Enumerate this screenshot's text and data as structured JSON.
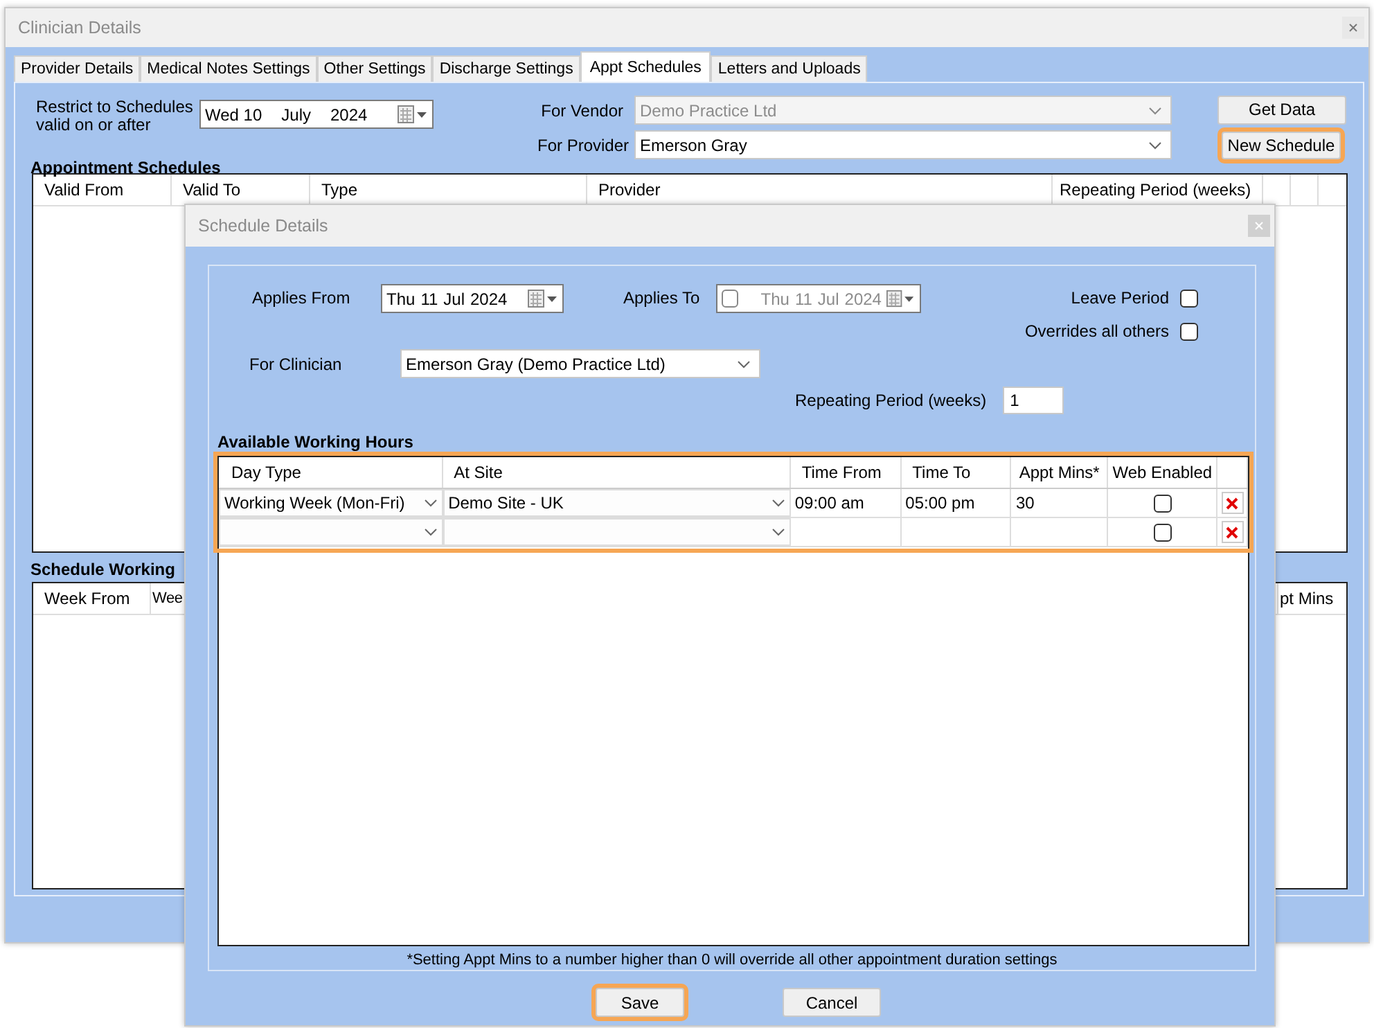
{
  "clinician_details": {
    "title": "Clinician Details",
    "tabs": [
      {
        "label": "Provider Details",
        "selected": false
      },
      {
        "label": "Medical Notes Settings",
        "selected": false
      },
      {
        "label": "Other Settings",
        "selected": false
      },
      {
        "label": "Discharge Settings",
        "selected": false
      },
      {
        "label": "Appt Schedules",
        "selected": true
      },
      {
        "label": "Letters and Uploads",
        "selected": false
      }
    ],
    "restrict": {
      "label": "Restrict to Schedules valid on or after",
      "date_parts": [
        "Wed 10",
        "July",
        "2024"
      ]
    },
    "vendor": {
      "label": "For Vendor",
      "value": "Demo Practice Ltd",
      "disabled": true
    },
    "provider": {
      "label": "For Provider",
      "value": "Emerson Gray",
      "disabled": false
    },
    "buttons": [
      {
        "label": "Get Data",
        "highlighted": false
      },
      {
        "label": "New Schedule",
        "highlighted": true
      }
    ],
    "appointment_schedules": {
      "title": "Appointment Schedules",
      "columns": [
        "Valid From",
        "Valid To",
        "Type",
        "Provider",
        "Repeating Period (weeks)"
      ]
    },
    "schedule_working_hours": {
      "title": "Schedule Working",
      "columns_left": [
        "Week From",
        "Wee"
      ],
      "columns_right": [
        "pt Mins"
      ]
    }
  },
  "schedule_details": {
    "title": "Schedule Details",
    "applies_from": {
      "label": "Applies From",
      "date_parts": [
        "Thu",
        "11",
        "Jul",
        "2024"
      ]
    },
    "applies_to": {
      "label": "Applies To",
      "checked": false,
      "date_parts": [
        "Thu",
        "11",
        "Jul",
        "2024"
      ]
    },
    "leave_period": {
      "label": "Leave Period",
      "checked": false
    },
    "overrides": {
      "label": "Overrides all others",
      "checked": false
    },
    "clinician": {
      "label": "For Clinician",
      "value": "Emerson Gray (Demo Practice Ltd)"
    },
    "repeating_period": {
      "label": "Repeating Period (weeks)",
      "value": "1"
    },
    "working_hours": {
      "title": "Available Working Hours",
      "highlighted": true,
      "columns": [
        "Day Type",
        "At Site",
        "Time From",
        "Time To",
        "Appt Mins*",
        "Web Enabled"
      ],
      "rows": [
        {
          "day_type": "Working Week (Mon-Fri)",
          "site": "Demo Site - UK",
          "time_from": "09:00 am",
          "time_to": "05:00 pm",
          "appt_mins": "30",
          "web_enabled": false
        },
        {
          "web_enabled": false
        }
      ]
    },
    "footnote": "*Setting Appt Mins to a number higher than 0 will override all other appointment duration settings",
    "buttons": [
      {
        "label": "Save",
        "highlighted": true
      },
      {
        "label": "Cancel",
        "highlighted": false
      }
    ]
  }
}
